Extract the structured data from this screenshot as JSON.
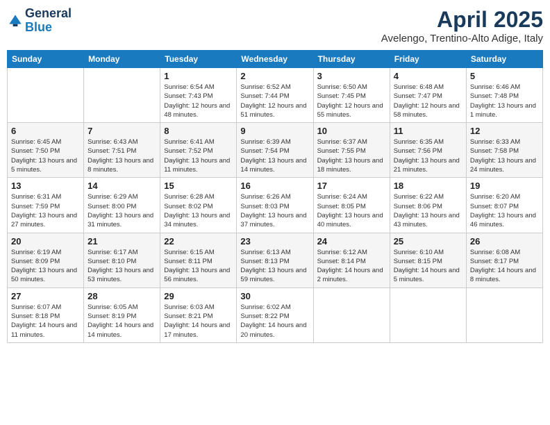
{
  "logo": {
    "line1": "General",
    "line2": "Blue"
  },
  "header": {
    "month": "April 2025",
    "location": "Avelengo, Trentino-Alto Adige, Italy"
  },
  "days_of_week": [
    "Sunday",
    "Monday",
    "Tuesday",
    "Wednesday",
    "Thursday",
    "Friday",
    "Saturday"
  ],
  "weeks": [
    [
      {
        "day": "",
        "info": ""
      },
      {
        "day": "",
        "info": ""
      },
      {
        "day": "1",
        "info": "Sunrise: 6:54 AM\nSunset: 7:43 PM\nDaylight: 12 hours and 48 minutes."
      },
      {
        "day": "2",
        "info": "Sunrise: 6:52 AM\nSunset: 7:44 PM\nDaylight: 12 hours and 51 minutes."
      },
      {
        "day": "3",
        "info": "Sunrise: 6:50 AM\nSunset: 7:45 PM\nDaylight: 12 hours and 55 minutes."
      },
      {
        "day": "4",
        "info": "Sunrise: 6:48 AM\nSunset: 7:47 PM\nDaylight: 12 hours and 58 minutes."
      },
      {
        "day": "5",
        "info": "Sunrise: 6:46 AM\nSunset: 7:48 PM\nDaylight: 13 hours and 1 minute."
      }
    ],
    [
      {
        "day": "6",
        "info": "Sunrise: 6:45 AM\nSunset: 7:50 PM\nDaylight: 13 hours and 5 minutes."
      },
      {
        "day": "7",
        "info": "Sunrise: 6:43 AM\nSunset: 7:51 PM\nDaylight: 13 hours and 8 minutes."
      },
      {
        "day": "8",
        "info": "Sunrise: 6:41 AM\nSunset: 7:52 PM\nDaylight: 13 hours and 11 minutes."
      },
      {
        "day": "9",
        "info": "Sunrise: 6:39 AM\nSunset: 7:54 PM\nDaylight: 13 hours and 14 minutes."
      },
      {
        "day": "10",
        "info": "Sunrise: 6:37 AM\nSunset: 7:55 PM\nDaylight: 13 hours and 18 minutes."
      },
      {
        "day": "11",
        "info": "Sunrise: 6:35 AM\nSunset: 7:56 PM\nDaylight: 13 hours and 21 minutes."
      },
      {
        "day": "12",
        "info": "Sunrise: 6:33 AM\nSunset: 7:58 PM\nDaylight: 13 hours and 24 minutes."
      }
    ],
    [
      {
        "day": "13",
        "info": "Sunrise: 6:31 AM\nSunset: 7:59 PM\nDaylight: 13 hours and 27 minutes."
      },
      {
        "day": "14",
        "info": "Sunrise: 6:29 AM\nSunset: 8:00 PM\nDaylight: 13 hours and 31 minutes."
      },
      {
        "day": "15",
        "info": "Sunrise: 6:28 AM\nSunset: 8:02 PM\nDaylight: 13 hours and 34 minutes."
      },
      {
        "day": "16",
        "info": "Sunrise: 6:26 AM\nSunset: 8:03 PM\nDaylight: 13 hours and 37 minutes."
      },
      {
        "day": "17",
        "info": "Sunrise: 6:24 AM\nSunset: 8:05 PM\nDaylight: 13 hours and 40 minutes."
      },
      {
        "day": "18",
        "info": "Sunrise: 6:22 AM\nSunset: 8:06 PM\nDaylight: 13 hours and 43 minutes."
      },
      {
        "day": "19",
        "info": "Sunrise: 6:20 AM\nSunset: 8:07 PM\nDaylight: 13 hours and 46 minutes."
      }
    ],
    [
      {
        "day": "20",
        "info": "Sunrise: 6:19 AM\nSunset: 8:09 PM\nDaylight: 13 hours and 50 minutes."
      },
      {
        "day": "21",
        "info": "Sunrise: 6:17 AM\nSunset: 8:10 PM\nDaylight: 13 hours and 53 minutes."
      },
      {
        "day": "22",
        "info": "Sunrise: 6:15 AM\nSunset: 8:11 PM\nDaylight: 13 hours and 56 minutes."
      },
      {
        "day": "23",
        "info": "Sunrise: 6:13 AM\nSunset: 8:13 PM\nDaylight: 13 hours and 59 minutes."
      },
      {
        "day": "24",
        "info": "Sunrise: 6:12 AM\nSunset: 8:14 PM\nDaylight: 14 hours and 2 minutes."
      },
      {
        "day": "25",
        "info": "Sunrise: 6:10 AM\nSunset: 8:15 PM\nDaylight: 14 hours and 5 minutes."
      },
      {
        "day": "26",
        "info": "Sunrise: 6:08 AM\nSunset: 8:17 PM\nDaylight: 14 hours and 8 minutes."
      }
    ],
    [
      {
        "day": "27",
        "info": "Sunrise: 6:07 AM\nSunset: 8:18 PM\nDaylight: 14 hours and 11 minutes."
      },
      {
        "day": "28",
        "info": "Sunrise: 6:05 AM\nSunset: 8:19 PM\nDaylight: 14 hours and 14 minutes."
      },
      {
        "day": "29",
        "info": "Sunrise: 6:03 AM\nSunset: 8:21 PM\nDaylight: 14 hours and 17 minutes."
      },
      {
        "day": "30",
        "info": "Sunrise: 6:02 AM\nSunset: 8:22 PM\nDaylight: 14 hours and 20 minutes."
      },
      {
        "day": "",
        "info": ""
      },
      {
        "day": "",
        "info": ""
      },
      {
        "day": "",
        "info": ""
      }
    ]
  ]
}
